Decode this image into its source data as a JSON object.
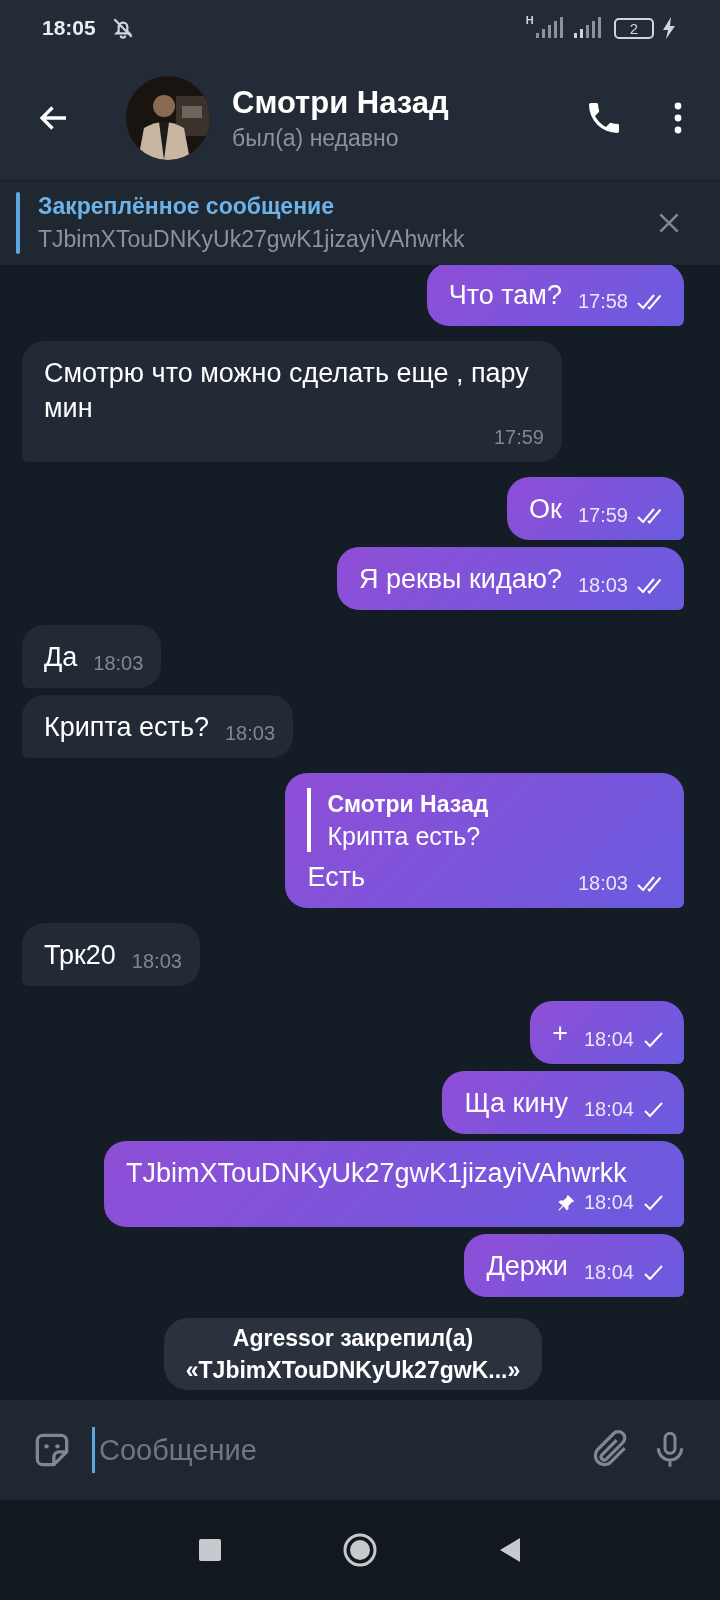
{
  "status_bar": {
    "time": "18:05",
    "network_label": "H",
    "battery": "2"
  },
  "header": {
    "name": "Смотри Назад",
    "status": "был(а) недавно"
  },
  "pinned": {
    "title": "Закреплённое сообщение",
    "text": "TJbimXTouDNKyUk27gwK1jizayiVAhwrkk"
  },
  "messages": [
    {
      "kind": "out",
      "text": "Что там?",
      "time": "17:58",
      "read": true,
      "pinned": false
    },
    {
      "kind": "in",
      "text": "Смотрю что можно сделать еще , пару мин",
      "time": "17:59"
    },
    {
      "kind": "out",
      "text": "Ок",
      "time": "17:59",
      "read": true,
      "pinned": false
    },
    {
      "kind": "out",
      "text": "Я реквы кидаю?",
      "time": "18:03",
      "read": true,
      "pinned": false
    },
    {
      "kind": "in",
      "text": "Да",
      "time": "18:03"
    },
    {
      "kind": "in",
      "text": "Крипта есть?",
      "time": "18:03"
    },
    {
      "kind": "out",
      "text": "Есть",
      "time": "18:03",
      "read": true,
      "pinned": false,
      "reply": {
        "author": "Смотри Назад",
        "text": "Крипта есть?"
      }
    },
    {
      "kind": "in",
      "text": "Трк20",
      "time": "18:03"
    },
    {
      "kind": "out",
      "text": "+",
      "time": "18:04",
      "read": false,
      "pinned": false
    },
    {
      "kind": "out",
      "text": "Ща кину",
      "time": "18:04",
      "read": false,
      "pinned": false
    },
    {
      "kind": "out",
      "text": "TJbimXTouDNKyUk27gwK1jizayiVAhwrkk",
      "time": "18:04",
      "read": false,
      "pinned": true
    },
    {
      "kind": "out",
      "text": "Держи",
      "time": "18:04",
      "read": false,
      "pinned": false
    },
    {
      "kind": "service",
      "lines": [
        "Agressor закрепил(а)",
        "«TJbimXTouDNKyUk27gwK...»"
      ]
    }
  ],
  "composer": {
    "placeholder": "Сообщение"
  }
}
